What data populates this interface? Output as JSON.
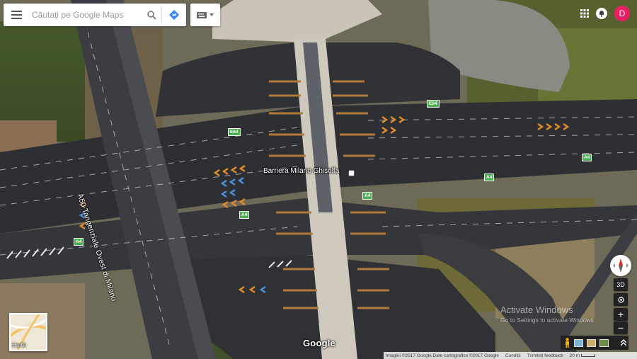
{
  "search": {
    "placeholder": "Căutați pe Google Maps"
  },
  "account": {
    "avatar_letter": "D"
  },
  "map": {
    "place_name": "Barriera Milano Ghisolfa",
    "road_name": "A50 Tangenziale Ovest di Milano",
    "shields": [
      "E64",
      "E64",
      "A4",
      "A4",
      "A4",
      "A4",
      "A4"
    ]
  },
  "layer_thumb": {
    "label": "Hartă"
  },
  "branding": {
    "logo": "Google"
  },
  "footer": {
    "attribution": "Imagini ©2017 Google,Date cartografice ©2017 Google",
    "terms": "Condiții",
    "feedback": "Trimiteți feedback",
    "scale": "20 m"
  },
  "watermark": {
    "title": "Activate Windows",
    "subtitle": "Go to Settings to activate Windows."
  },
  "controls": {
    "tilt": "3D",
    "zoom_in": "+",
    "zoom_out": "−"
  },
  "colors": {
    "avatar": "#e91e63",
    "shield": "#4caf50",
    "accent_blue": "#4285f4"
  }
}
